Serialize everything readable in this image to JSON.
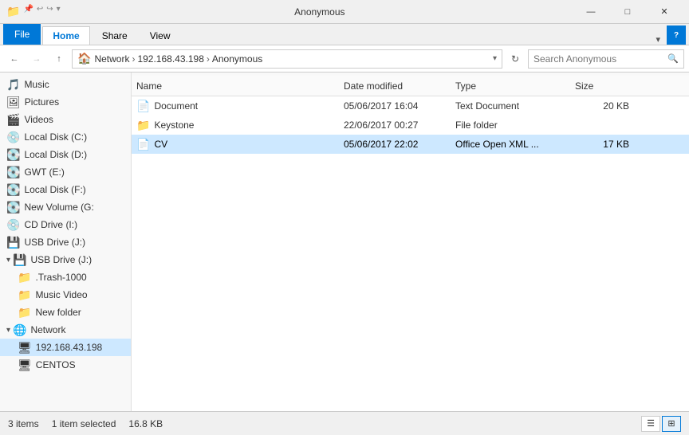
{
  "titleBar": {
    "title": "Anonymous",
    "icons": [
      "folder-icon"
    ],
    "minimize": "—",
    "maximize": "□",
    "close": "✕"
  },
  "ribbon": {
    "fileTab": "File",
    "tabs": [
      {
        "label": "Home",
        "active": true
      },
      {
        "label": "Share",
        "active": false
      },
      {
        "label": "View",
        "active": false
      }
    ],
    "dropdownArrow": "▾",
    "helpIcon": "?"
  },
  "addressBar": {
    "backDisabled": false,
    "forwardDisabled": true,
    "upEnabled": true,
    "pathItems": [
      "Network",
      "192.168.43.198",
      "Anonymous"
    ],
    "dropdownArrow": "▾",
    "refreshIcon": "↻",
    "searchPlaceholder": "Search Anonymous",
    "searchIcon": "🔍"
  },
  "sidebar": {
    "items": [
      {
        "id": "music",
        "label": "Music",
        "icon": "🎵",
        "indent": 0,
        "type": "item"
      },
      {
        "id": "pictures",
        "label": "Pictures",
        "icon": "🖼",
        "indent": 0,
        "type": "item"
      },
      {
        "id": "videos",
        "label": "Videos",
        "icon": "🎬",
        "indent": 0,
        "type": "item"
      },
      {
        "id": "localC",
        "label": "Local Disk (C:)",
        "icon": "💿",
        "indent": 0,
        "type": "item"
      },
      {
        "id": "localD",
        "label": "Local Disk (D:)",
        "icon": "💽",
        "indent": 0,
        "type": "item"
      },
      {
        "id": "gwt",
        "label": "GWT (E:)",
        "icon": "💽",
        "indent": 0,
        "type": "item"
      },
      {
        "id": "localF",
        "label": "Local Disk (F:)",
        "icon": "💽",
        "indent": 0,
        "type": "item"
      },
      {
        "id": "newVolG",
        "label": "New Volume (G:",
        "icon": "💽",
        "indent": 0,
        "type": "item"
      },
      {
        "id": "cdI",
        "label": "CD Drive (I:)",
        "icon": "💿",
        "indent": 0,
        "type": "item"
      },
      {
        "id": "usbJ1",
        "label": "USB Drive (J:)",
        "icon": "💾",
        "indent": 0,
        "type": "item"
      },
      {
        "id": "usbJ2-header",
        "label": "USB Drive (J:)",
        "icon": "💾",
        "indent": 0,
        "type": "section"
      },
      {
        "id": "trash",
        "label": ".Trash-1000",
        "icon": "📁",
        "indent": 1,
        "type": "item"
      },
      {
        "id": "musicVideo",
        "label": "Music Video",
        "icon": "📁",
        "indent": 1,
        "type": "item"
      },
      {
        "id": "newFolder",
        "label": "New folder",
        "icon": "📁",
        "indent": 1,
        "type": "item"
      },
      {
        "id": "network-header",
        "label": "Network",
        "icon": "🌐",
        "indent": 0,
        "type": "section"
      },
      {
        "id": "ip192",
        "label": "192.168.43.198",
        "icon": "🖥",
        "indent": 1,
        "type": "item",
        "selected": true
      },
      {
        "id": "centos",
        "label": "CENTOS",
        "icon": "🖥",
        "indent": 1,
        "type": "item"
      }
    ]
  },
  "fileList": {
    "columns": [
      {
        "id": "name",
        "label": "Name"
      },
      {
        "id": "date",
        "label": "Date modified"
      },
      {
        "id": "type",
        "label": "Type"
      },
      {
        "id": "size",
        "label": "Size"
      }
    ],
    "rows": [
      {
        "id": "document",
        "name": "Document",
        "icon": "📄",
        "date": "05/06/2017 16:04",
        "type": "Text Document",
        "size": "20 KB",
        "selected": false
      },
      {
        "id": "keystone",
        "name": "Keystone",
        "icon": "📁",
        "date": "22/06/2017 00:27",
        "type": "File folder",
        "size": "",
        "selected": false
      },
      {
        "id": "cv",
        "name": "CV",
        "icon": "📄",
        "date": "05/06/2017 22:02",
        "type": "Office Open XML ...",
        "size": "17 KB",
        "selected": true
      }
    ]
  },
  "statusBar": {
    "itemCount": "3 items",
    "selectedInfo": "1 item selected",
    "selectedSize": "16.8 KB",
    "viewDetails": "☰",
    "viewGrid": "⊞"
  },
  "colors": {
    "accent": "#0078d7",
    "selectedBg": "#cde8ff",
    "hoverBg": "#e5f1fb",
    "ribbonBg": "#f0f0f0",
    "sidebarBg": "#f8f8f8"
  }
}
